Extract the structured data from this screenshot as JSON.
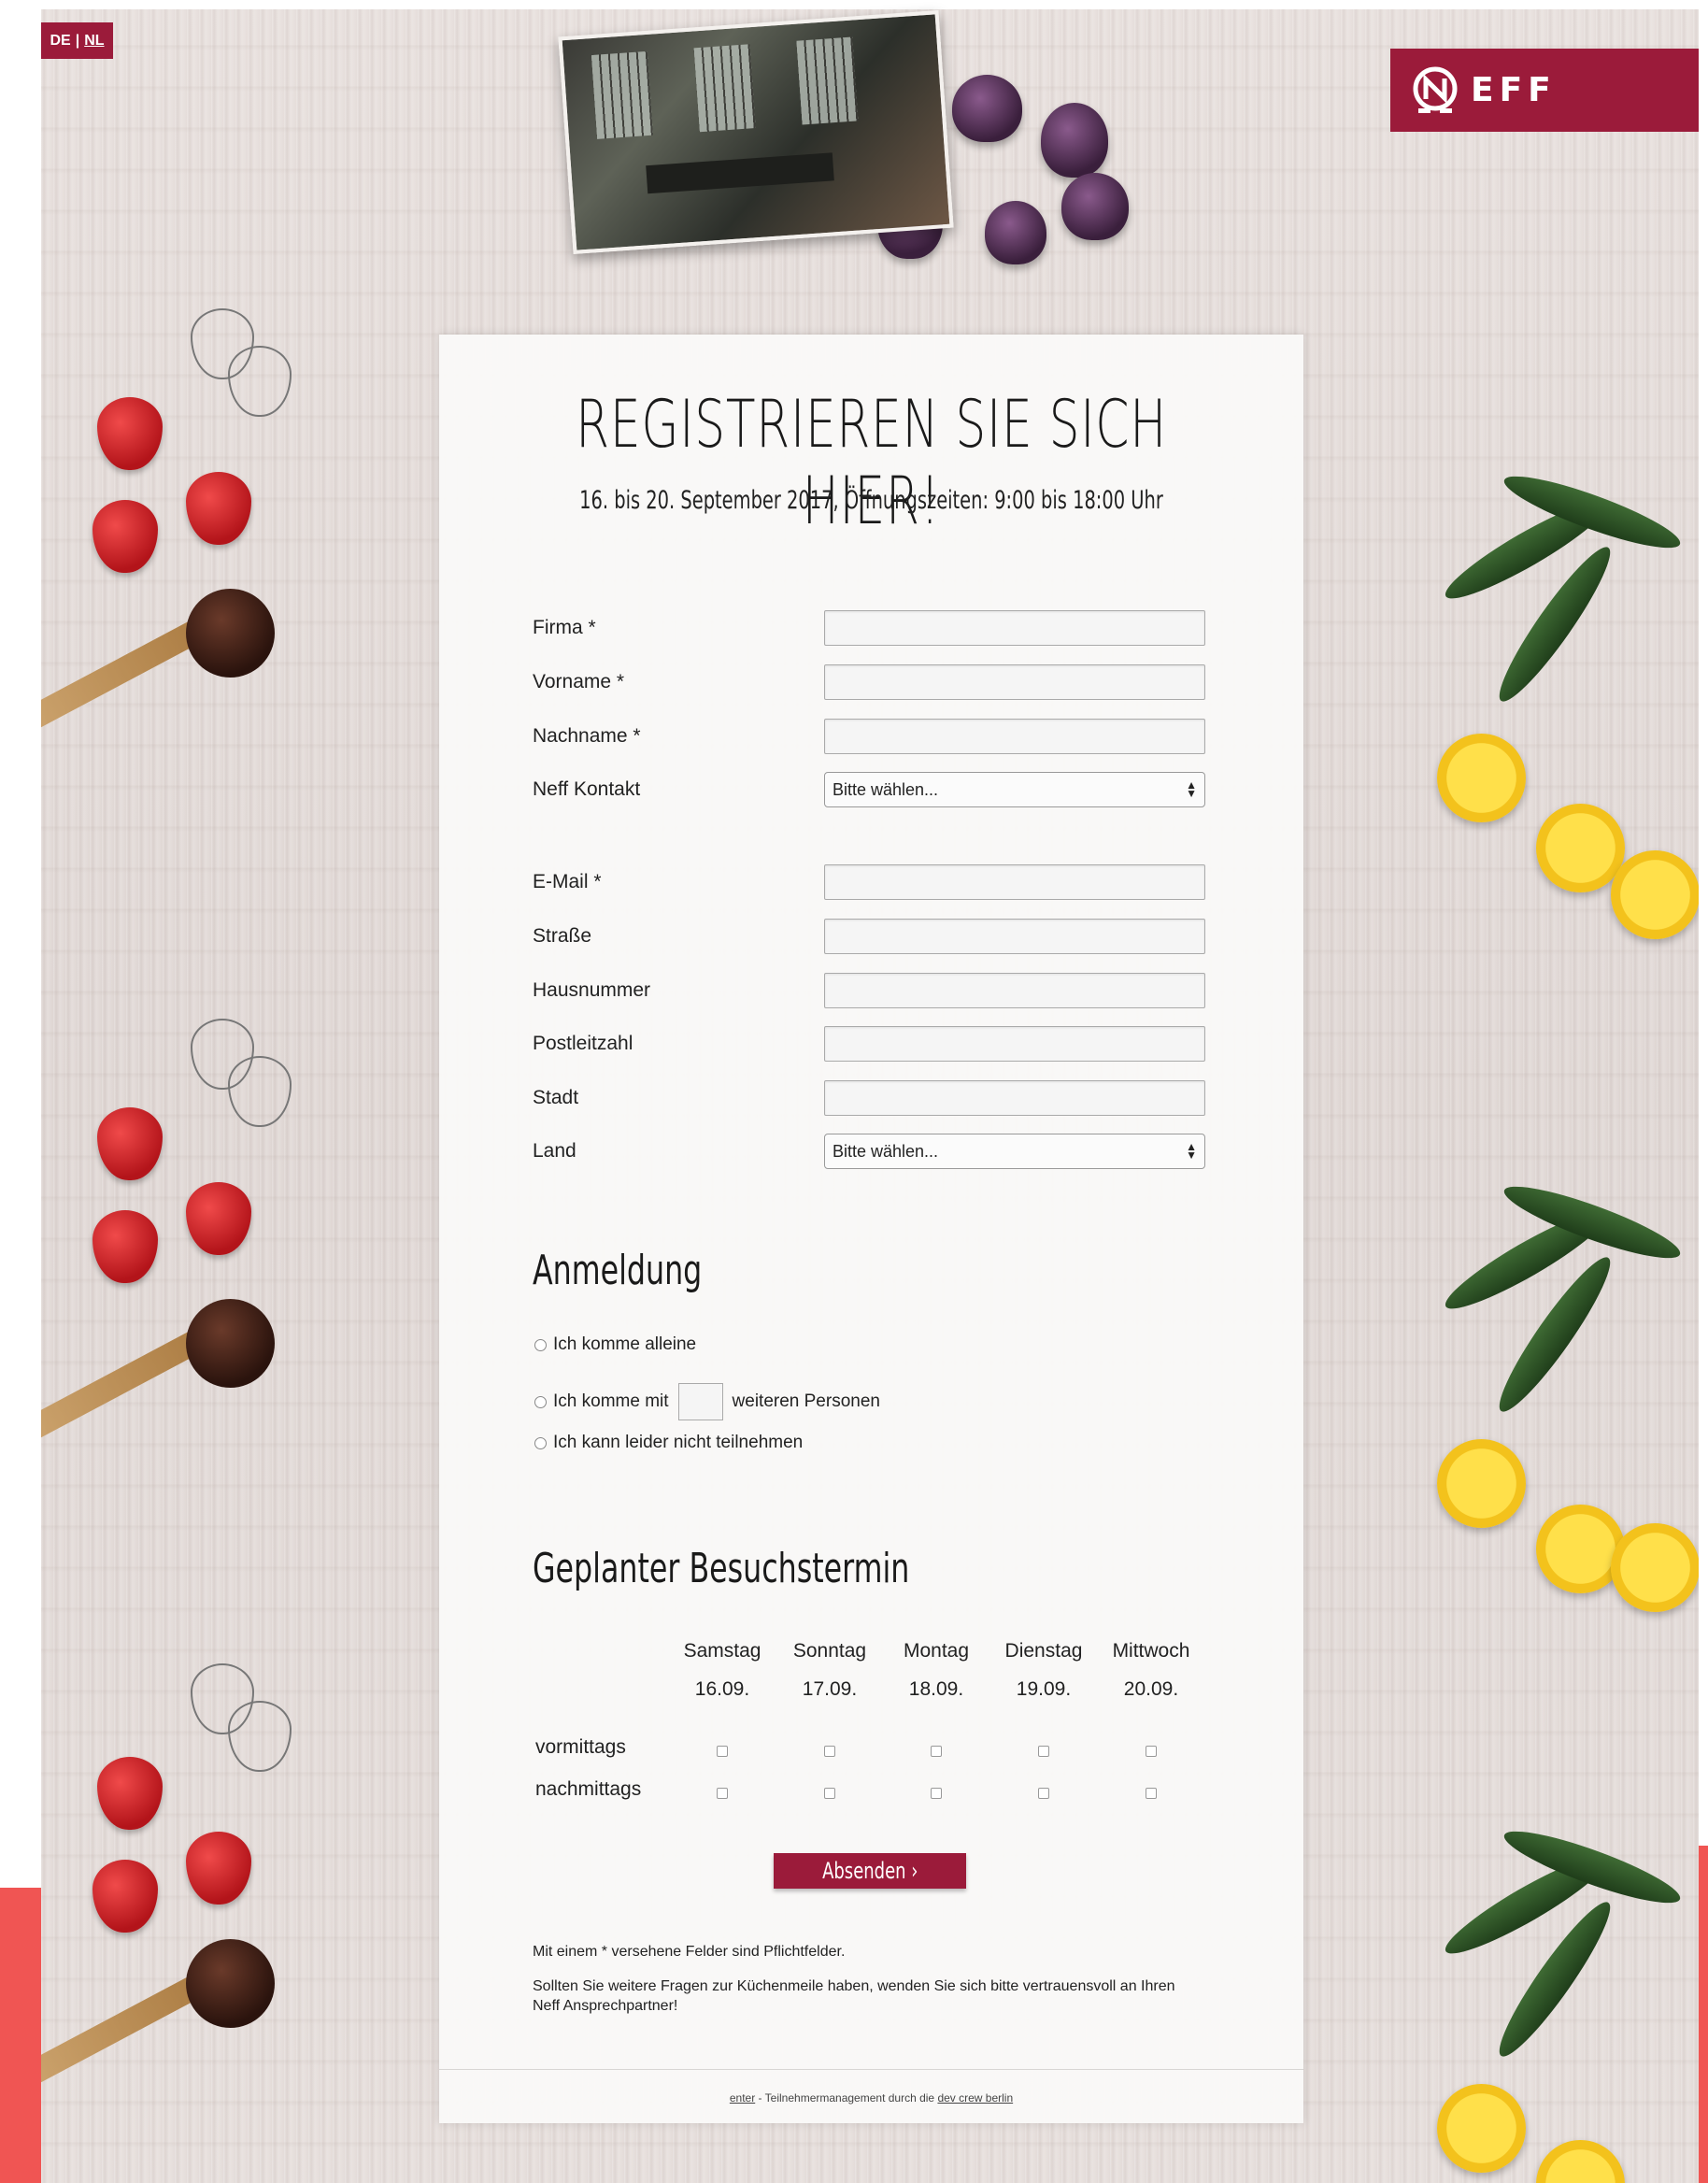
{
  "lang": {
    "de": "DE",
    "separator": "|",
    "nl": "NL"
  },
  "logo": {
    "text": "EFF"
  },
  "form": {
    "title": "REGISTRIEREN SIE SICH HIER!",
    "subtitle": "16. bis 20. September 2017, Öffnungszeiten: 9:00 bis 18:00 Uhr",
    "fields": {
      "firma": "Firma *",
      "vorname": "Vorname *",
      "nachname": "Nachname *",
      "neff_kontakt": "Neff Kontakt",
      "email": "E-Mail *",
      "strasse": "Straße",
      "hausnummer": "Hausnummer",
      "postleitzahl": "Postleitzahl",
      "stadt": "Stadt",
      "land": "Land"
    },
    "select_placeholder": "Bitte wählen...",
    "anmeldung": {
      "heading": "Anmeldung",
      "option_alone": "Ich komme alleine",
      "option_with_prefix": "Ich komme mit",
      "option_with_suffix": "weiteren Personen",
      "option_decline": "Ich kann leider nicht teilnehmen"
    },
    "besuch": {
      "heading": "Geplanter Besuchstermin",
      "days": [
        {
          "name": "Samstag",
          "date": "16.09."
        },
        {
          "name": "Sonntag",
          "date": "17.09."
        },
        {
          "name": "Montag",
          "date": "18.09."
        },
        {
          "name": "Dienstag",
          "date": "19.09."
        },
        {
          "name": "Mittwoch",
          "date": "20.09."
        }
      ],
      "slots": [
        "vormittags",
        "nachmittags"
      ]
    },
    "submit_label": "Absenden ›",
    "note_required": "Mit einem * versehene Felder sind Pflichtfelder.",
    "note_contact": "Sollten Sie weitere Fragen zur Küchenmeile haben, wenden Sie sich bitte vertrauensvoll an Ihren Neff Ansprechpartner!"
  },
  "footer": {
    "link1": "enter",
    "text": " - Teilnehmermanagement durch die ",
    "link2": "dev crew berlin"
  }
}
